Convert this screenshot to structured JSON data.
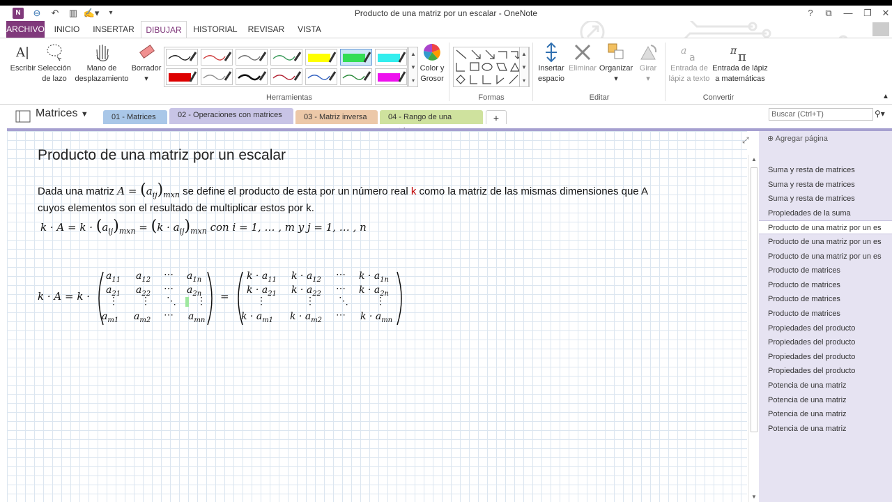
{
  "window": {
    "title": "Producto de una matriz por un escalar - OneNote",
    "help": "?",
    "restore_ribbon": "⧉",
    "minimize": "—",
    "maximize": "❐",
    "close": "✕"
  },
  "ribbon_tabs": [
    "ARCHIVO",
    "INICIO",
    "INSERTAR",
    "DIBUJAR",
    "HISTORIAL",
    "REVISAR",
    "VISTA"
  ],
  "ribbon": {
    "buttons": {
      "escribir": "Escribir",
      "seleccion": "Selección de lazo",
      "mano": "Mano de desplazamiento",
      "borrador": "Borrador",
      "color": "Color y Grosor",
      "insertar_espacio": "Insertar espacio",
      "eliminar": "Eliminar",
      "organizar": "Organizar",
      "girar": "Girar",
      "entrada_texto": "Entrada de lápiz a texto",
      "entrada_mat": "Entrada de lápiz a matemáticas"
    },
    "groups": {
      "herramientas": "Herramientas",
      "formas": "Formas",
      "editar": "Editar",
      "convertir": "Convertir"
    },
    "pen_colors": [
      "#222222",
      "#d04040",
      "#707070",
      "#3a9a5a",
      "#ffff00",
      "#33dd55",
      "#33eeee",
      "#dd0000",
      "#909090",
      "#111111",
      "#b02030",
      "#3060c0",
      "#2a8a3a",
      "#ee11ee"
    ]
  },
  "notebook": {
    "name": "Matrices",
    "sections": [
      {
        "label": "01 - Matrices",
        "color": "#a9c7e8"
      },
      {
        "label": "02 - Operaciones con matrices",
        "color": "#c8c4e6"
      },
      {
        "label": "03 - Matriz inversa",
        "color": "#ecc8a8"
      },
      {
        "label": "04 - Rango de una matriz",
        "color": "#cfe29e"
      }
    ],
    "add_section": "+",
    "search_placeholder": "Buscar (Ctrl+T)"
  },
  "page": {
    "title": "Producto de una matriz por un escalar",
    "intro_a": "Dada una matriz ",
    "intro_b": " se define el producto de esta por un número real ",
    "intro_k": "k",
    "intro_c": " como la matriz de las mismas dimensiones que A",
    "line2": "cuyos elementos son el resultado de multiplicar estos por k."
  },
  "pages_panel": {
    "add_page": "Agregar página",
    "items": [
      "Suma y resta de matrices",
      "Suma y resta de matrices",
      "Suma y resta de matrices",
      "Propiedades de la suma",
      "Producto de una matriz por un es",
      "Producto de una matriz por un es",
      "Producto de una matriz por un es",
      "Producto de matrices",
      "Producto de matrices",
      "Producto de matrices",
      "Producto de matrices",
      "Propiedades del producto",
      "Propiedades del producto",
      "Propiedades del producto",
      "Propiedades del producto",
      "Potencia de una matriz",
      "Potencia de una matriz",
      "Potencia de una matriz",
      "Potencia de una matriz"
    ],
    "active_index": 4
  }
}
